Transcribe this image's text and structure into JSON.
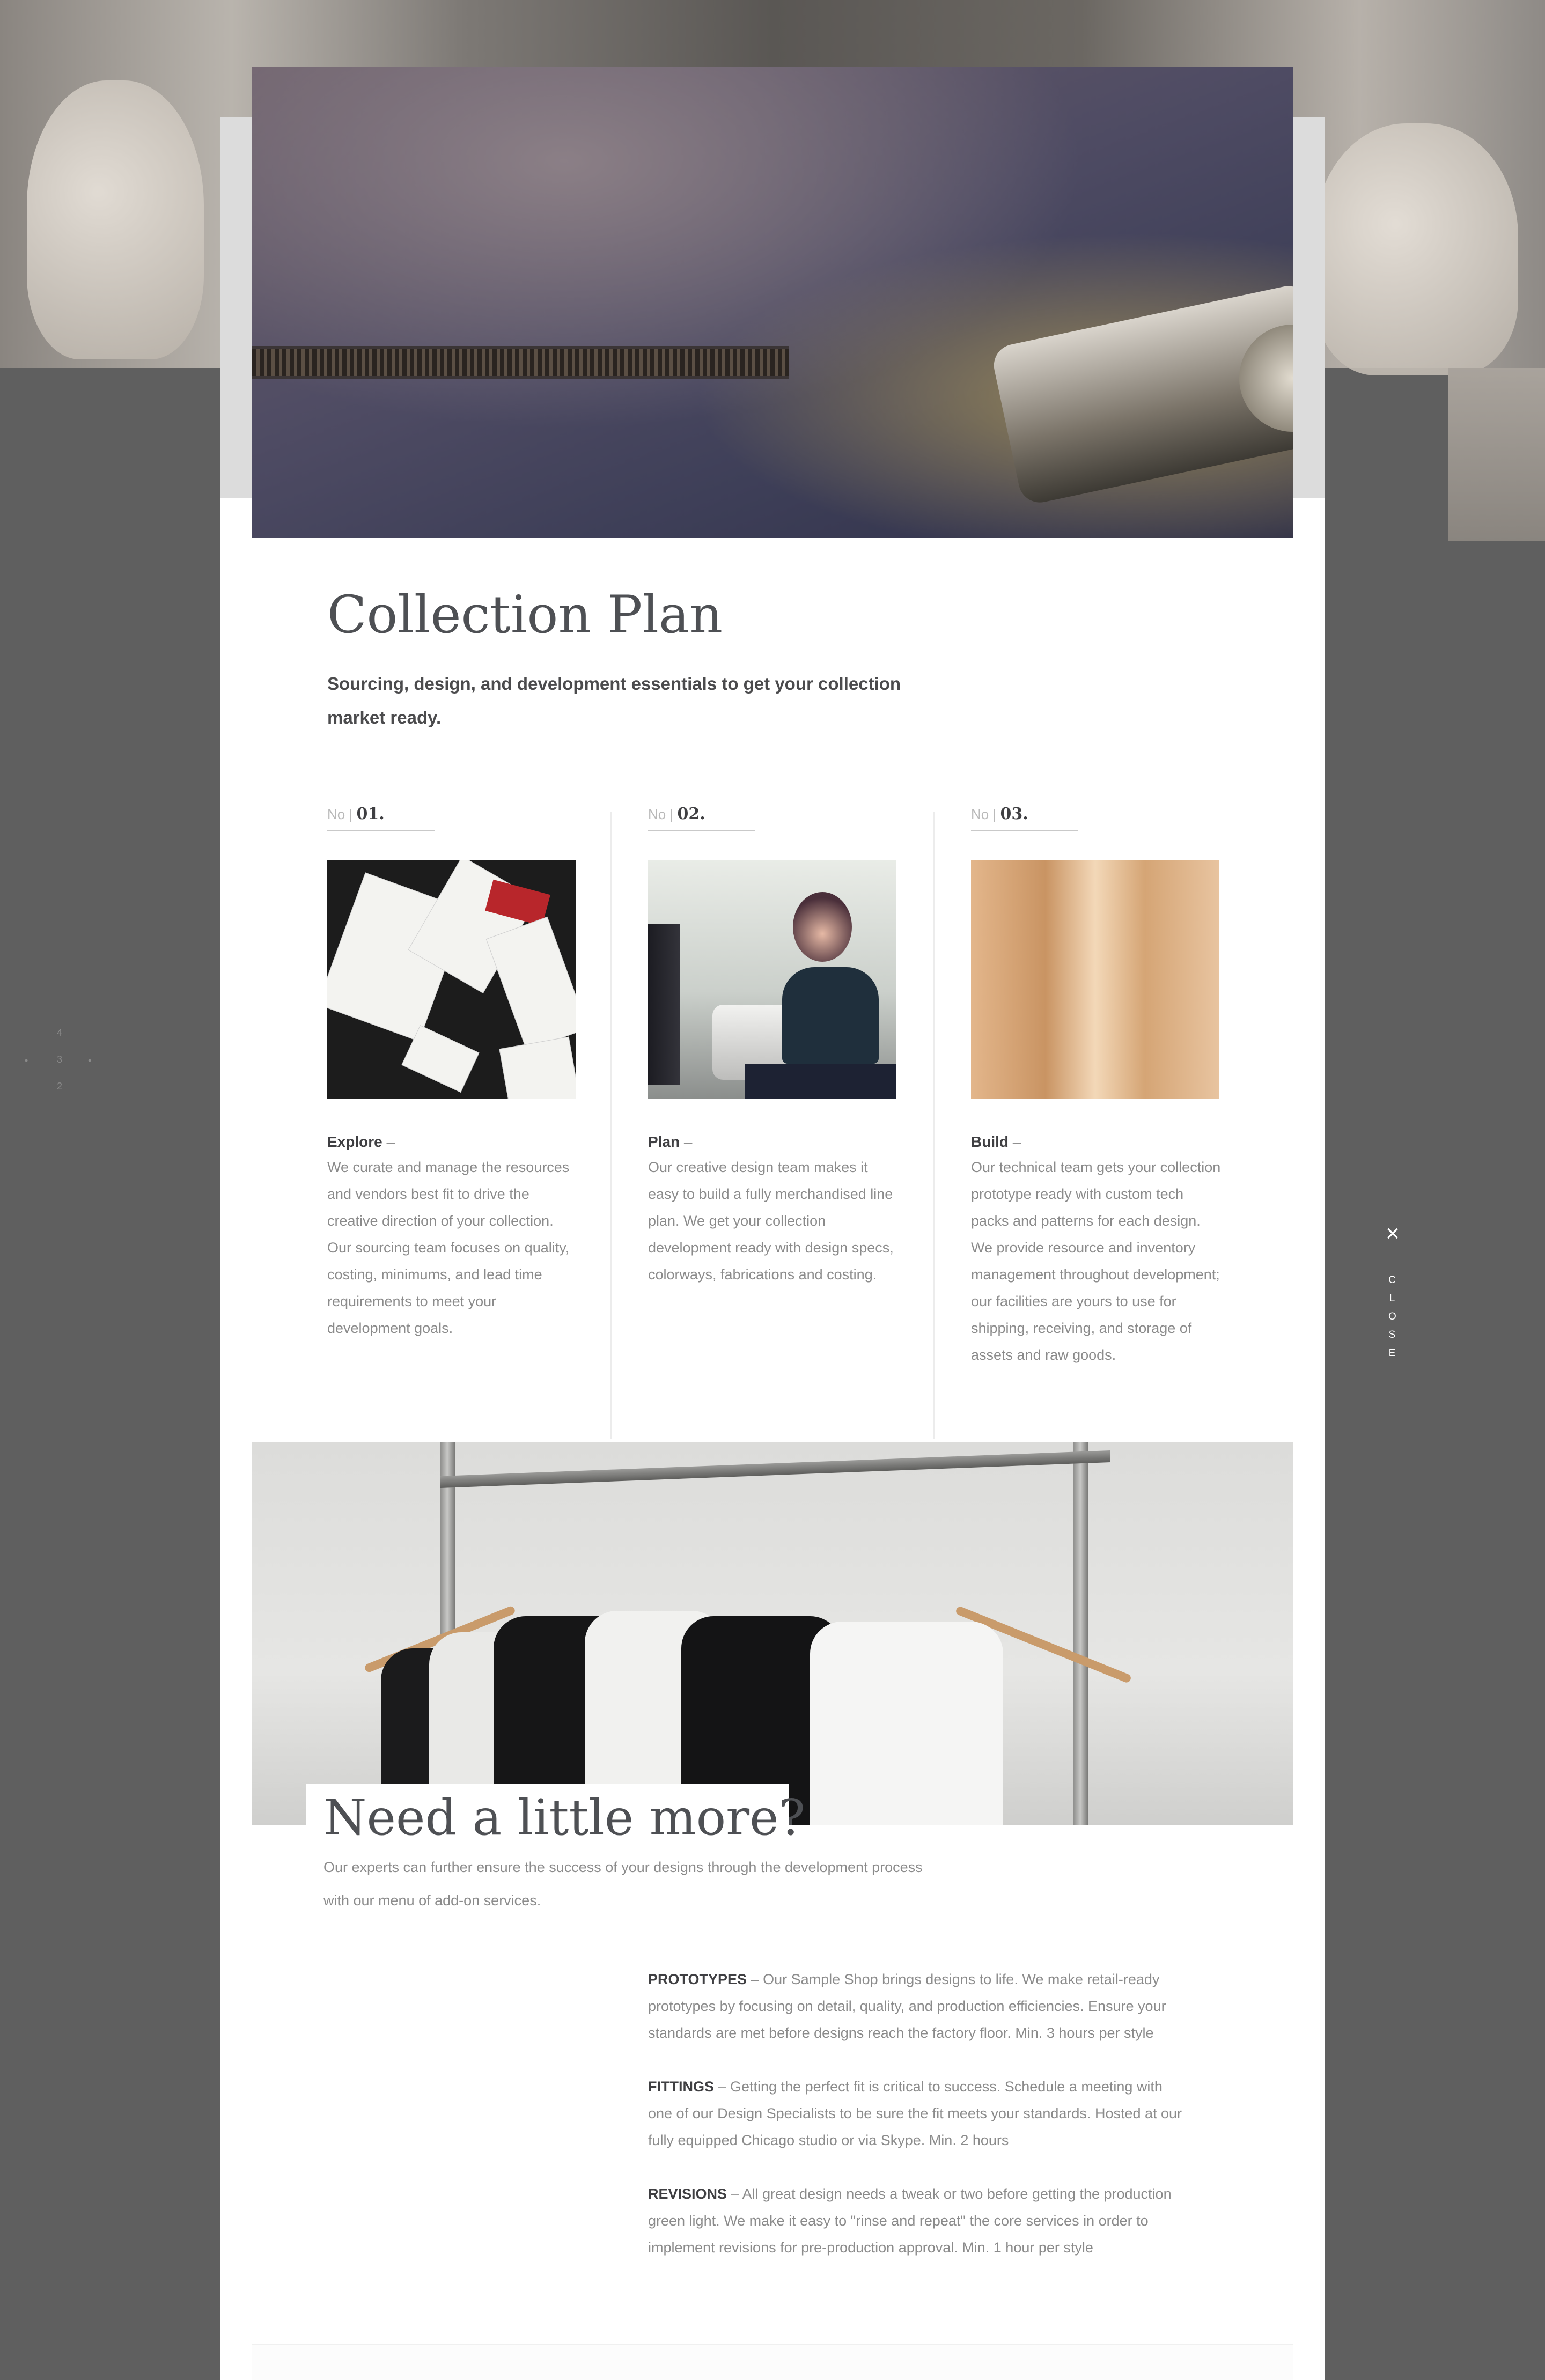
{
  "collection": {
    "title": "Collection Plan",
    "subtitle": "Sourcing, design, and development essentials to get your collection market ready."
  },
  "steps": [
    {
      "no_label": "No |",
      "number": "01.",
      "heading": "Explore",
      "text": "We curate and manage the resources and vendors best fit to drive the creative direction of your collection. Our sourcing team focuses on quality, costing, minimums, and lead time requirements to meet your development goals."
    },
    {
      "no_label": "No |",
      "number": "02.",
      "heading": "Plan",
      "text": "Our creative design team makes it easy to build a fully merchandised line plan. We get your collection development ready with design specs, colorways, fabrications and costing."
    },
    {
      "no_label": "No |",
      "number": "03.",
      "heading": "Build",
      "text": "Our technical team gets your collection prototype ready with custom tech packs and patterns for each design. We provide resource and inventory management throughout development; our facilities are yours to use for shipping, receiving, and storage of assets and raw goods."
    }
  ],
  "heading_dash": " –",
  "more": {
    "title": "Need a little more?",
    "text": "Our experts can further ensure the success of your designs through the development process with our menu of add-on services."
  },
  "services": [
    {
      "name": "PROTOTYPES",
      "text": " – Our Sample Shop brings designs to life. We make retail-ready prototypes by focusing on detail, quality, and production efficiencies. Ensure your standards are met before designs reach the factory floor. Min. 3 hours per style"
    },
    {
      "name": "FITTINGS",
      "text": " – Getting the perfect fit is critical to success. Schedule a meeting with one of our Design Specialists to be sure the fit meets your standards. Hosted at our fully equipped Chicago studio or via Skype.  Min. 2 hours"
    },
    {
      "name": "REVISIONS",
      "text": " – All great design needs a tweak or two before getting the production green light. We make it easy to \"rinse and repeat\" the core services in order to implement revisions for pre-production approval. Min. 1 hour per style"
    }
  ],
  "close": {
    "icon": "close-icon",
    "glyph": "×",
    "label": "CLOSE"
  },
  "pager": {
    "top": "4",
    "left": "•",
    "middle": "3",
    "right": "•",
    "bottom": "2"
  }
}
